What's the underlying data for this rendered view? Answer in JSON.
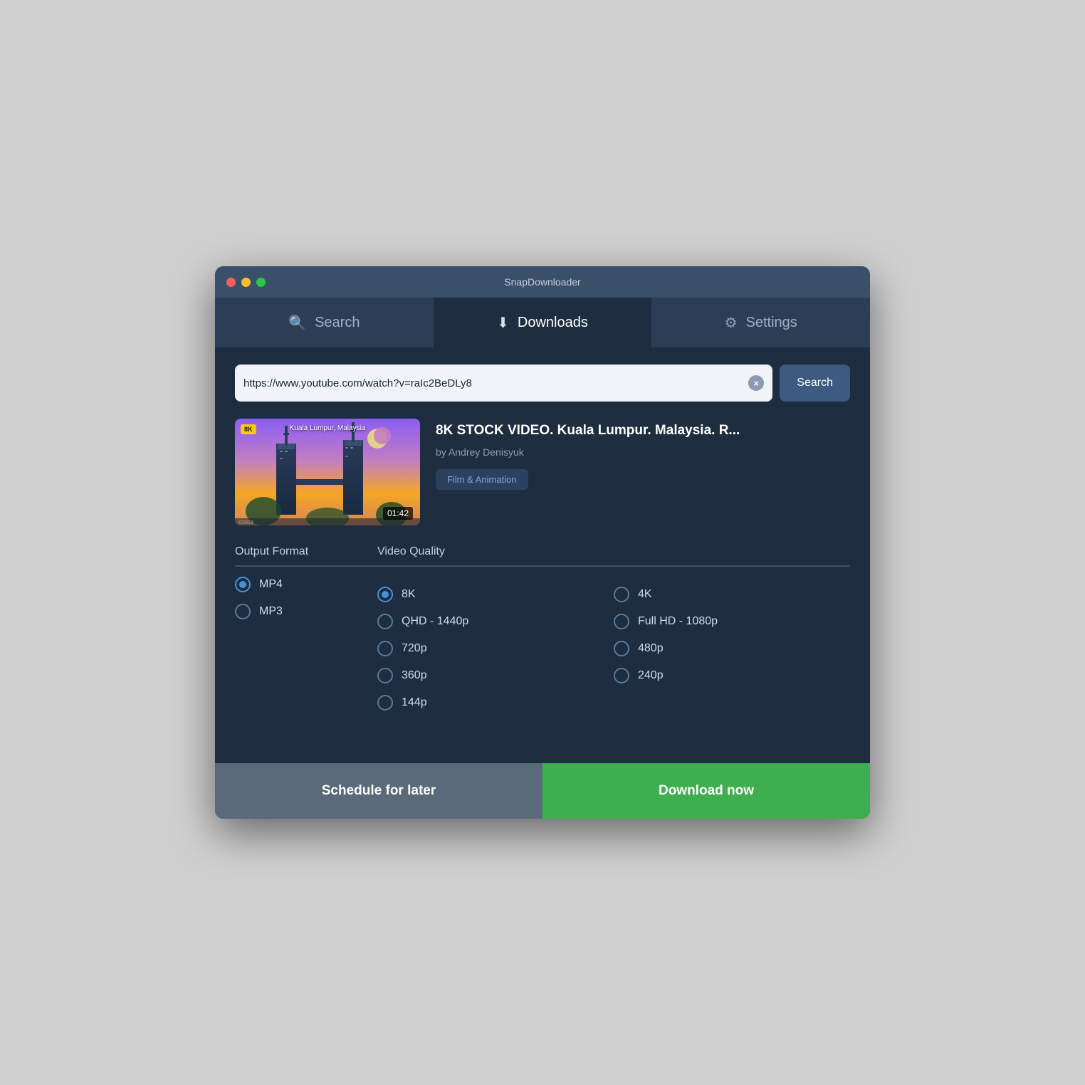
{
  "app": {
    "title": "SnapDownloader",
    "window_controls": {
      "close": "close",
      "minimize": "minimize",
      "maximize": "maximize"
    }
  },
  "tabs": [
    {
      "id": "search",
      "label": "Search",
      "icon": "🔍",
      "active": false
    },
    {
      "id": "downloads",
      "label": "Downloads",
      "icon": "⬇",
      "active": false
    },
    {
      "id": "settings",
      "label": "Settings",
      "icon": "⚙",
      "active": false
    }
  ],
  "search_bar": {
    "url_value": "https://www.youtube.com/watch?v=raIc2BeDLy8",
    "url_placeholder": "Enter URL",
    "clear_label": "×",
    "search_button_label": "Search"
  },
  "video": {
    "title": "8K STOCK VIDEO. Kuala Lumpur. Malaysia. R...",
    "author": "by Andrey Denisyuk",
    "category": "Film & Animation",
    "duration": "01:42",
    "location_badge": "Kuala Lumpur, Malaysia",
    "resolution_badge": "8K",
    "thumbnail_alt": "Kuala Lumpur skyline thumbnail"
  },
  "output_format": {
    "label": "Output Format",
    "options": [
      {
        "id": "mp4",
        "label": "MP4",
        "selected": true
      },
      {
        "id": "mp3",
        "label": "MP3",
        "selected": false
      }
    ]
  },
  "video_quality": {
    "label": "Video Quality",
    "options_col1": [
      {
        "id": "8k",
        "label": "8K",
        "selected": true
      },
      {
        "id": "qhd",
        "label": "QHD - 1440p",
        "selected": false
      },
      {
        "id": "720p",
        "label": "720p",
        "selected": false
      },
      {
        "id": "360p",
        "label": "360p",
        "selected": false
      },
      {
        "id": "144p",
        "label": "144p",
        "selected": false
      }
    ],
    "options_col2": [
      {
        "id": "4k",
        "label": "4K",
        "selected": false
      },
      {
        "id": "1080p",
        "label": "Full HD - 1080p",
        "selected": false
      },
      {
        "id": "480p",
        "label": "480p",
        "selected": false
      },
      {
        "id": "240p",
        "label": "240p",
        "selected": false
      }
    ]
  },
  "buttons": {
    "schedule_label": "Schedule for later",
    "download_label": "Download now"
  }
}
